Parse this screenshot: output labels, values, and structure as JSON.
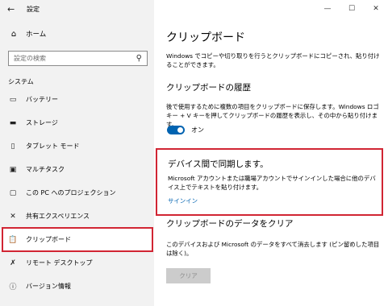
{
  "window": {
    "title": "設定"
  },
  "sidebar": {
    "home": "ホーム",
    "search_placeholder": "設定の検索",
    "section": "システム",
    "items": [
      {
        "label": "バッテリー",
        "icon": "battery-icon"
      },
      {
        "label": "ストレージ",
        "icon": "storage-icon"
      },
      {
        "label": "タブレット モード",
        "icon": "tablet-mode-icon"
      },
      {
        "label": "マルチタスク",
        "icon": "multitasking-icon"
      },
      {
        "label": "この PC へのプロジェクション",
        "icon": "projecting-icon"
      },
      {
        "label": "共有エクスペリエンス",
        "icon": "shared-experiences-icon"
      },
      {
        "label": "クリップボード",
        "icon": "clipboard-icon"
      },
      {
        "label": "リモート デスクトップ",
        "icon": "remote-desktop-icon"
      },
      {
        "label": "バージョン情報",
        "icon": "info-icon"
      }
    ]
  },
  "main": {
    "title": "クリップボード",
    "intro": "Windows でコピーや切り取りを行うとクリップボードにコピーされ、貼り付けることができます。",
    "history_heading": "クリップボードの履歴",
    "history_desc": "後で使用するために複数の項目をクリップボードに保存します。Windows ロゴ キー + V キーを押してクリップボードの履歴を表示し、その中から貼り付けます。",
    "history_toggle": {
      "state": "オン",
      "on": true
    },
    "sync_heading": "デバイス間で同期します。",
    "sync_desc": "Microsoft アカウントまたは職場アカウントでサインインした場合に他のデバイス上でテキストを貼り付けます。",
    "sync_link": "サインイン",
    "clear_heading": "クリップボードのデータをクリア",
    "clear_desc": "このデバイスおよび Microsoft のデータをすべて消去します (ピン留めした項目は除く)。",
    "clear_button": "クリア"
  },
  "colors": {
    "accent": "#0063b1",
    "highlight_outline": "#d12533"
  }
}
